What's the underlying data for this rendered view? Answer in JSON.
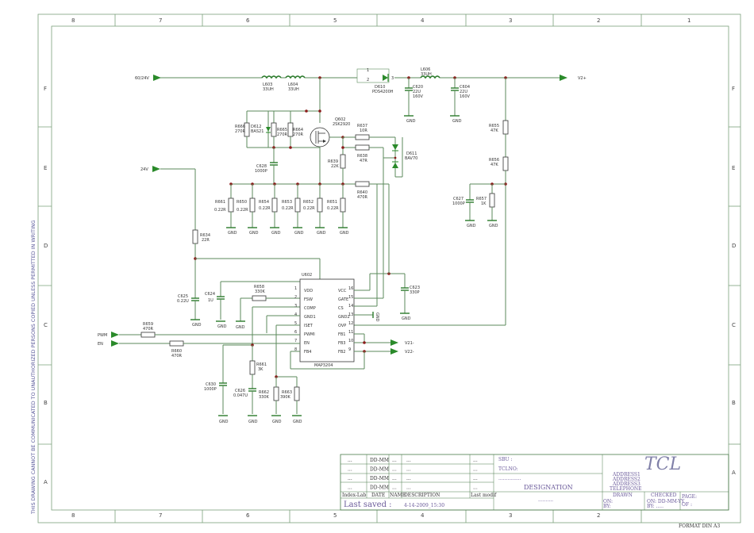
{
  "frame": {
    "columns": [
      "8",
      "7",
      "6",
      "5",
      "4",
      "3",
      "2",
      "1"
    ],
    "rows": [
      "F",
      "E",
      "D",
      "C",
      "B",
      "A"
    ],
    "side_note": "THIS DRAWING CANNOT BE COMMUNICATED TO UNAUTHORIZED PERSONS COPIED UNLESS PERMITTED IN WRITING",
    "format": "FORMAT DIN A3"
  },
  "nets": {
    "in_60_24": "60/24V",
    "in_24": "24V",
    "out_v2plus": "V2+",
    "pwm": "PWM",
    "en": "EN",
    "v21m": "V21-",
    "v22m": "V22-"
  },
  "components": {
    "L603": [
      "L603",
      "33UH"
    ],
    "L604": [
      "L604",
      "33UH"
    ],
    "L606": [
      "L606",
      "33UH"
    ],
    "D610": [
      "D610",
      "PDS4200H"
    ],
    "C620": [
      "C620",
      "22U",
      "160V"
    ],
    "C604": [
      "C604",
      "22U",
      "160V"
    ],
    "R655": [
      "R655",
      "47K"
    ],
    "R656": [
      "R656",
      "47K"
    ],
    "C627": [
      "C627",
      "1000P"
    ],
    "R657": [
      "R657",
      "1K"
    ],
    "R666": [
      "R666",
      "270R"
    ],
    "D612": [
      "D612",
      "BAS21"
    ],
    "R665": [
      "R665",
      "270R"
    ],
    "R664": [
      "R664",
      "270R"
    ],
    "Q602": [
      "Q602",
      "2SK2920"
    ],
    "R637": [
      "R637",
      "10R"
    ],
    "R638": [
      "R638",
      "47R"
    ],
    "D611": [
      "D611",
      "BAV70"
    ],
    "R639": [
      "R639",
      "22K"
    ],
    "C628": [
      "C628",
      "1000P"
    ],
    "R640": [
      "R640",
      "470R"
    ],
    "R661": [
      "R661",
      "0.22R"
    ],
    "R650": [
      "R650",
      "0.22R"
    ],
    "R654": [
      "R654",
      "0.22R"
    ],
    "R653": [
      "R653",
      "0.22R"
    ],
    "R652": [
      "R652",
      "0.22R"
    ],
    "R651": [
      "R651",
      "0.22R"
    ],
    "R634": [
      "R634",
      "22R"
    ],
    "C625": [
      "C625",
      "0.22U"
    ],
    "C624": [
      "C624",
      "1U"
    ],
    "R658": [
      "R658",
      "330K"
    ],
    "C623": [
      "C623",
      "330P"
    ],
    "R659": [
      "R659",
      "470R"
    ],
    "R660": [
      "R660",
      "470R"
    ],
    "R661b": [
      "R661",
      "3K"
    ],
    "C630": [
      "C630",
      "1000P"
    ],
    "C626": [
      "C626",
      "0.047U"
    ],
    "R662": [
      "R662",
      "330K"
    ],
    "R663": [
      "R663",
      "390K"
    ]
  },
  "ic": {
    "ref": "U602",
    "part": "MAP3204",
    "left_pins": [
      {
        "n": "1",
        "name": "VDD"
      },
      {
        "n": "2",
        "name": "FSW"
      },
      {
        "n": "3",
        "name": "COMP"
      },
      {
        "n": "4",
        "name": "GND1"
      },
      {
        "n": "5",
        "name": "ISET"
      },
      {
        "n": "6",
        "name": "PWMI"
      },
      {
        "n": "7",
        "name": "EN"
      },
      {
        "n": "8",
        "name": "FB4"
      }
    ],
    "right_pins": [
      {
        "n": "16",
        "name": "VCC"
      },
      {
        "n": "15",
        "name": "GATE"
      },
      {
        "n": "14",
        "name": "CS"
      },
      {
        "n": "13",
        "name": "GND2"
      },
      {
        "n": "12",
        "name": "OVP"
      },
      {
        "n": "11",
        "name": "FB1"
      },
      {
        "n": "10",
        "name": "FB3"
      },
      {
        "n": "9",
        "name": "FB2"
      }
    ]
  },
  "gnd_label": "GND",
  "title_block": {
    "rev_rows": [
      {
        "c1": "...",
        "c2": "DD-MM",
        "c3": "...",
        "c4": "..."
      },
      {
        "c1": "...",
        "c2": "DD-MM",
        "c3": "...",
        "c4": "..."
      },
      {
        "c1": "...",
        "c2": "DD-MM",
        "c3": "...",
        "c4": "..."
      },
      {
        "c1": "...",
        "c2": "DD-MM",
        "c3": "...",
        "c4": "..."
      }
    ],
    "headers": [
      "Index-Lab",
      "DATE",
      "NAME",
      "DESCRIPTION",
      "Last modif"
    ],
    "last_saved_label": "Last saved :",
    "last_saved_value": "4-14-2009_15:30",
    "sbu": "SBU :",
    "tclno": "TCLNO:",
    "dots": "...............",
    "designation": "DESIGNATION",
    "designation_dots": "..........",
    "brand": "TCL",
    "address": [
      "ADDRESS1",
      "ADDRESS2",
      "ADDRESS3",
      "TELEPHONE"
    ],
    "drawn": "DRAWN",
    "checked": "CHECKED",
    "on1": "ON:",
    "by1": "BY:",
    "on2": "ON: DD-MM-YY",
    "by2": "BY: .....",
    "page": "PAGE:",
    "of": "OF :"
  }
}
